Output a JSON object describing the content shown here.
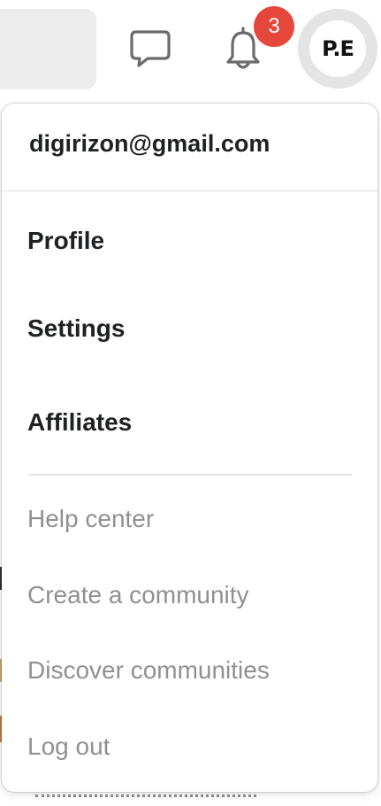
{
  "header": {
    "notification_count": "3",
    "avatar_initials": "P.E"
  },
  "menu": {
    "email": "digirizon@gmail.com",
    "primary_items": [
      "Profile",
      "Settings",
      "Affiliates"
    ],
    "secondary_items": [
      "Help center",
      "Create a community",
      "Discover communities",
      "Log out"
    ]
  },
  "colors": {
    "badge": "#e5473a",
    "primary_text": "#202124",
    "secondary_text": "#909090",
    "avatar_ring": "#e4e4e4"
  }
}
